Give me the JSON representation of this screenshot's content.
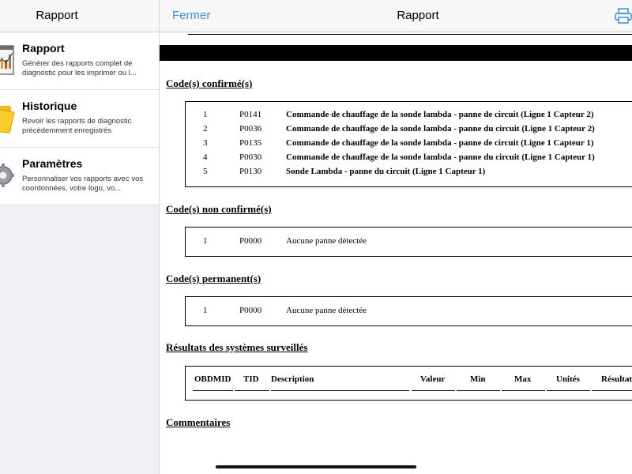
{
  "sidebar": {
    "title": "Rapport",
    "items": [
      {
        "title": "Rapport",
        "description": "Générer des rapports complet de diagnostic pour les imprimer ou l...",
        "icon": "report-chart-icon"
      },
      {
        "title": "Historique",
        "description": "Revoir les rapports de diagnostic précédemment enregistrés",
        "icon": "folder-icon"
      },
      {
        "title": "Paramètres",
        "description": "Personnaliser vos rapports avec vos coordonnées, votre logo, vo...",
        "icon": "gear-icon"
      }
    ]
  },
  "navbar": {
    "close_label": "Fermer",
    "title": "Rapport",
    "print_icon": "printer-icon",
    "accent_color": "#3a8ef0"
  },
  "report": {
    "confirmed": {
      "title": "Code(s) confirmé(s)",
      "rows": [
        {
          "num": "1",
          "code": "P0141",
          "desc": "Commande de chauffage de la sonde lambda - panne de circuit (Ligne 1 Capteur 2)"
        },
        {
          "num": "2",
          "code": "P0036",
          "desc": "Commande de chauffage de la sonde lambda - panne du circuit (Ligne 1 Capteur 2)"
        },
        {
          "num": "3",
          "code": "P0135",
          "desc": "Commande de chauffage de la sonde lambda - panne de circuit (Ligne 1 Capteur 1)"
        },
        {
          "num": "4",
          "code": "P0030",
          "desc": "Commande de chauffage de la sonde lambda - panne du circuit (Ligne 1 Capteur 1)"
        },
        {
          "num": "5",
          "code": "P0130",
          "desc": "Sonde Lambda - panne du circuit (Ligne 1 Capteur 1)"
        }
      ]
    },
    "unconfirmed": {
      "title": "Code(s) non confirmé(s)",
      "rows": [
        {
          "num": "1",
          "code": "P0000",
          "desc": "Aucune panne détectée"
        }
      ]
    },
    "permanent": {
      "title": "Code(s) permanent(s)",
      "rows": [
        {
          "num": "1",
          "code": "P0000",
          "desc": "Aucune panne détectée"
        }
      ]
    },
    "monitors": {
      "title": "Résultats des systèmes surveillés",
      "headers": [
        "OBDMID",
        "TID",
        "Description",
        "Valeur",
        "Min",
        "Max",
        "Unités",
        "Résultat"
      ]
    },
    "comments": {
      "title": "Commentaires"
    }
  }
}
